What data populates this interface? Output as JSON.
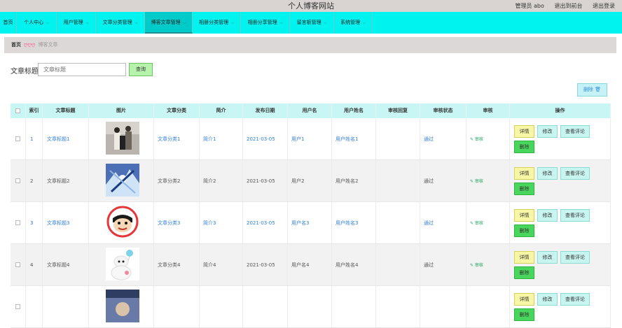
{
  "header": {
    "site_title": "个人博客网站",
    "admin_label": "管理员 abo",
    "back_front": "退出到前台",
    "logout": "退出登录"
  },
  "nav": {
    "items": [
      {
        "label": "首页",
        "caret": false
      },
      {
        "label": "个人中心",
        "caret": true
      },
      {
        "label": "用户管理",
        "caret": true
      },
      {
        "label": "文章分类管理",
        "caret": true
      },
      {
        "label": "博客文章管理",
        "caret": true,
        "active": true
      },
      {
        "label": "相册分类管理",
        "caret": true
      },
      {
        "label": "相册分享管理",
        "caret": true
      },
      {
        "label": "留言板管理",
        "caret": true
      },
      {
        "label": "系统管理",
        "caret": true
      }
    ],
    "caret_glyph": "⌵"
  },
  "breadcrumb": {
    "home": "首页",
    "separator": "ღღღ",
    "current": "博客文章"
  },
  "search": {
    "label": "文章标题",
    "placeholder": "文章标题",
    "button": "查询"
  },
  "toolbar": {
    "delete_label": "删除 🗑"
  },
  "table": {
    "columns": [
      "",
      "索引",
      "文章标题",
      "图片",
      "文章分类",
      "简介",
      "发布日期",
      "用户名",
      "用户姓名",
      "审核回复",
      "审核状态",
      "审核",
      "操作"
    ],
    "audit_link": "✎ 审核",
    "ops": {
      "detail": "详情",
      "edit": "修改",
      "comments": "查看评论",
      "delete": "删除"
    },
    "rows": [
      {
        "index": "1",
        "title": "文章标题1",
        "category": "文章分类1",
        "intro": "简介1",
        "date": "2021-03-05",
        "username": "用户1",
        "name": "用户姓名1",
        "reply": "",
        "status": "通过",
        "image": "photo-people-icon",
        "link_style": true
      },
      {
        "index": "2",
        "title": "文章标题2",
        "category": "文章分类2",
        "intro": "简介2",
        "date": "2021-03-05",
        "username": "用户2",
        "name": "用户姓名2",
        "reply": "",
        "status": "通过",
        "image": "anime-art-icon",
        "link_style": false
      },
      {
        "index": "3",
        "title": "文章标题3",
        "category": "文章分类3",
        "intro": "简介3",
        "date": "2021-03-05",
        "username": "用户名3",
        "name": "用户姓名3",
        "reply": "",
        "status": "通过",
        "image": "cartoon-face-icon",
        "link_style": true
      },
      {
        "index": "4",
        "title": "文章标题4",
        "category": "文章分类4",
        "intro": "简介4",
        "date": "2021-03-05",
        "username": "用户名4",
        "name": "用户姓名4",
        "reply": "",
        "status": "通过",
        "image": "white-robot-icon",
        "link_style": false
      },
      {
        "index": "",
        "title": "",
        "category": "",
        "intro": "",
        "date": "",
        "username": "",
        "name": "",
        "reply": "",
        "status": "",
        "image": "photo-partial-icon",
        "link_style": false
      }
    ]
  },
  "colors": {
    "nav_bg": "#00f3ef",
    "nav_active": "#00cbc8",
    "header_bg": "#d9d4d2",
    "table_head": "#c8f6f4"
  }
}
